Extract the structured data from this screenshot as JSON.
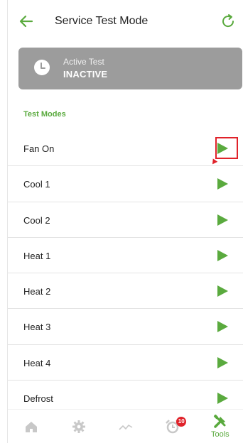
{
  "header": {
    "title": "Service Test Mode",
    "back_icon": "arrow-left-icon",
    "refresh_icon": "refresh-icon"
  },
  "active_test": {
    "label": "Active Test",
    "value": "INACTIVE",
    "icon": "clock-icon"
  },
  "section_title": "Test Modes",
  "test_modes": [
    {
      "label": "Fan On",
      "highlighted": true
    },
    {
      "label": "Cool 1"
    },
    {
      "label": "Cool 2"
    },
    {
      "label": "Heat 1"
    },
    {
      "label": "Heat 2"
    },
    {
      "label": "Heat 3"
    },
    {
      "label": "Heat 4"
    },
    {
      "label": "Defrost"
    }
  ],
  "bottom_nav": [
    {
      "name": "home",
      "icon": "home-icon"
    },
    {
      "name": "settings",
      "icon": "gear-icon"
    },
    {
      "name": "history",
      "icon": "trend-icon"
    },
    {
      "name": "alerts",
      "icon": "alarm-clock-icon",
      "badge": "10"
    },
    {
      "name": "tools",
      "icon": "tools-icon",
      "label": "Tools",
      "active": true
    }
  ],
  "colors": {
    "accent": "#5aaa3e",
    "card": "#9c9c9c",
    "highlight": "#e0222a",
    "inactive_icon": "#c8c8c8"
  }
}
